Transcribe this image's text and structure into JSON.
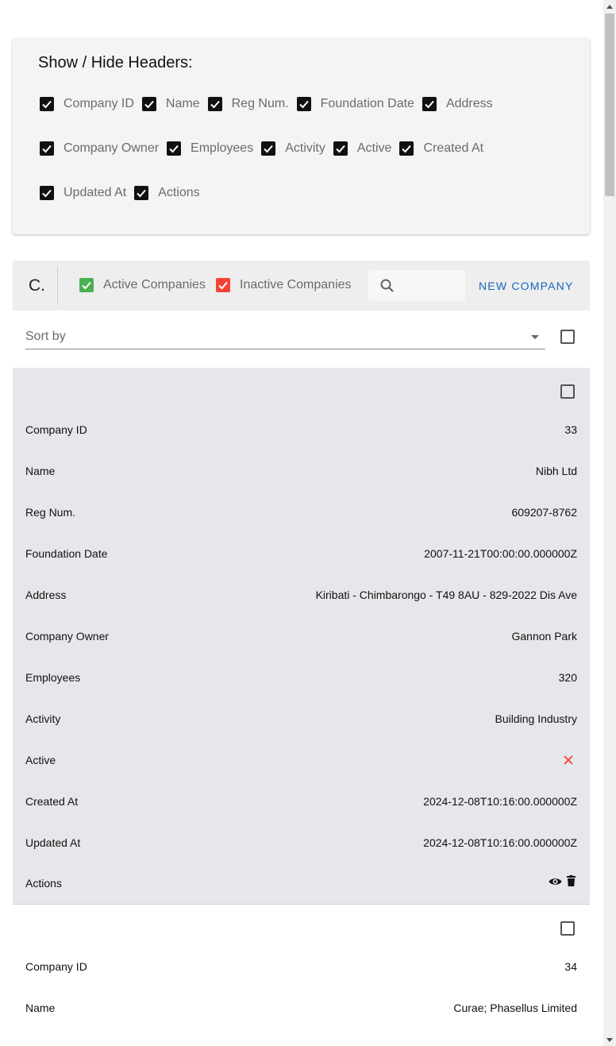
{
  "headers_panel": {
    "title": "Show / Hide Headers:",
    "row1": [
      "Company ID",
      "Name",
      "Reg Num.",
      "Foundation Date",
      "Address"
    ],
    "row2": [
      "Company Owner",
      "Employees",
      "Activity",
      "Active",
      "Created At"
    ],
    "row3": [
      "Updated At",
      "Actions"
    ]
  },
  "toolbar": {
    "logo": "C.",
    "active_label": "Active Companies",
    "inactive_label": "Inactive Companies",
    "new_button": "NEW COMPANY"
  },
  "sort": {
    "label": "Sort by"
  },
  "colors": {
    "active": "#4caf50",
    "inactive": "#f44336",
    "accent": "#1565c0"
  },
  "records": [
    {
      "rows": [
        {
          "k": "Company ID",
          "v": "33"
        },
        {
          "k": "Name",
          "v": "Nibh Ltd"
        },
        {
          "k": "Reg Num.",
          "v": "609207-8762"
        },
        {
          "k": "Foundation Date",
          "v": "2007-11-21T00:00:00.000000Z"
        },
        {
          "k": "Address",
          "v": "Kiribati - Chimbarongo - T49 8AU - 829-2022 Dis Ave"
        },
        {
          "k": "Company Owner",
          "v": "Gannon Park"
        },
        {
          "k": "Employees",
          "v": "320"
        },
        {
          "k": "Activity",
          "v": "Building Industry"
        },
        {
          "k": "Active",
          "v": ""
        },
        {
          "k": "Created At",
          "v": "2024-12-08T10:16:00.000000Z"
        },
        {
          "k": "Updated At",
          "v": "2024-12-08T10:16:00.000000Z"
        },
        {
          "k": "Actions",
          "v": ""
        }
      ]
    },
    {
      "rows": [
        {
          "k": "Company ID",
          "v": "34"
        },
        {
          "k": "Name",
          "v": "Curae; Phasellus Limited"
        }
      ]
    }
  ]
}
